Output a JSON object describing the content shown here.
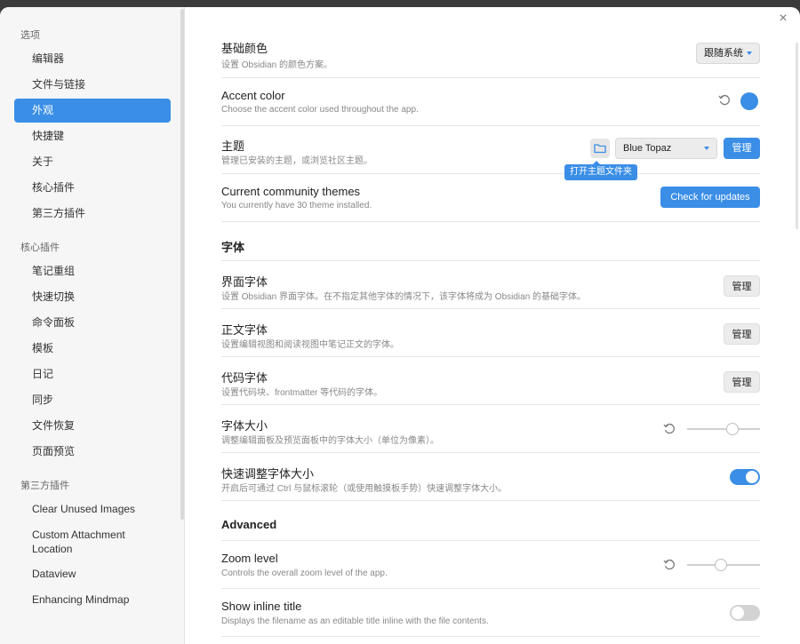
{
  "sidebar": {
    "groups": [
      {
        "heading": "选项",
        "items": [
          "编辑器",
          "文件与链接",
          "外观",
          "快捷键",
          "关于",
          "核心插件",
          "第三方插件"
        ]
      },
      {
        "heading": "核心插件",
        "items": [
          "笔记重组",
          "快速切换",
          "命令面板",
          "模板",
          "日记",
          "同步",
          "文件恢复",
          "页面预览"
        ]
      },
      {
        "heading": "第三方插件",
        "items": [
          "Clear Unused Images",
          "Custom Attachment Location",
          "Dataview",
          "Enhancing Mindmap"
        ]
      }
    ],
    "active_item": "外观"
  },
  "close_symbol": "×",
  "settings": {
    "base_color": {
      "title": "基础颜色",
      "desc": "设置 Obsidian 的颜色方案。",
      "value": "跟随系统"
    },
    "accent_color": {
      "title": "Accent color",
      "desc": "Choose the accent color used throughout the app.",
      "color": "#3a8ee6"
    },
    "theme": {
      "title": "主题",
      "desc": "管理已安装的主题，或浏览社区主题。",
      "value": "Blue Topaz",
      "manage": "管理",
      "tooltip": "打开主题文件夹"
    },
    "community_themes": {
      "title": "Current community themes",
      "desc": "You currently have 30 theme installed.",
      "button": "Check for updates"
    },
    "font_section": "字体",
    "interface_font": {
      "title": "界面字体",
      "desc": "设置 Obsidian 界面字体。在不指定其他字体的情况下，该字体将成为 Obsidian 的基础字体。",
      "button": "管理"
    },
    "text_font": {
      "title": "正文字体",
      "desc": "设置编辑视图和阅读视图中笔记正文的字体。",
      "button": "管理"
    },
    "code_font": {
      "title": "代码字体",
      "desc": "设置代码块、frontmatter 等代码的字体。",
      "button": "管理"
    },
    "font_size": {
      "title": "字体大小",
      "desc": "调整编辑面板及预览面板中的字体大小（单位为像素）。",
      "level": 0.65
    },
    "quick_font": {
      "title": "快速调整字体大小",
      "desc": "开启后可通过 Ctrl 与鼠标滚轮（或使用触摸板手势）快速调整字体大小。",
      "enabled": true
    },
    "advanced_section": "Advanced",
    "zoom": {
      "title": "Zoom level",
      "desc": "Controls the overall zoom level of the app.",
      "level": 0.45
    },
    "inline_title": {
      "title": "Show inline title",
      "desc": "Displays the filename as an editable title inline with the file contents.",
      "enabled": false
    }
  },
  "colors": {
    "accent": "#3a8ee6"
  },
  "icons": [
    "close-icon",
    "reset-icon",
    "folder-icon",
    "chevron-down-icon"
  ]
}
